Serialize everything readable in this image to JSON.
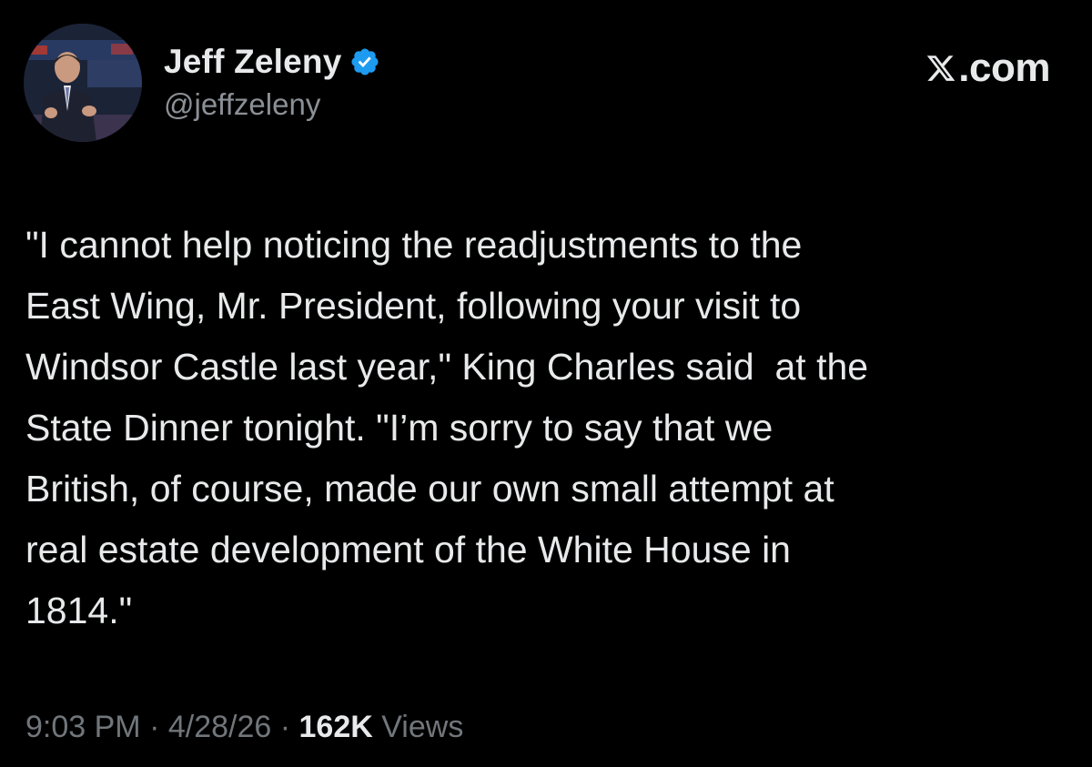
{
  "post": {
    "author": {
      "display_name": "Jeff Zeleny",
      "handle": "@jeffzeleny",
      "verified": true,
      "verified_icon": "verified-badge-icon",
      "verified_color": "#1d9bf0"
    },
    "brand": {
      "text": ".com",
      "icon": "x-logo-icon"
    },
    "text_lines": [
      "\"I cannot help noticing the readjustments to the",
      "East Wing, Mr. President, following your visit to",
      "Windsor Castle last year,\" King Charles said  at the",
      "State Dinner tonight. \"I’m sorry to say that we",
      "British, of course, made our own small attempt at",
      "real estate development of the White House in",
      "1814.\""
    ],
    "meta": {
      "time": "9:03 PM",
      "separator": " · ",
      "date": "4/28/26",
      "views_count": "162K",
      "views_label": " Views"
    }
  },
  "colors": {
    "background": "#000000",
    "primary_text": "#e7e9ea",
    "secondary_text": "#71767b",
    "accent": "#1d9bf0"
  }
}
